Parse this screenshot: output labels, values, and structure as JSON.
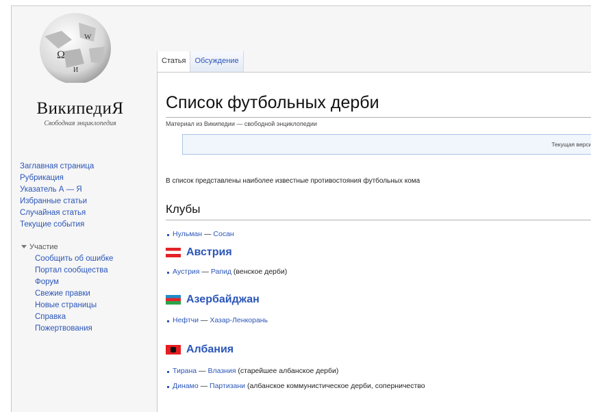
{
  "logo": {
    "wordmark": "ВикипедиЯ",
    "tagline": "Свободная энциклопедия"
  },
  "sidebar": {
    "nav": [
      {
        "label": "Заглавная страница"
      },
      {
        "label": "Рубрикация"
      },
      {
        "label": "Указатель А — Я"
      },
      {
        "label": "Избранные статьи"
      },
      {
        "label": "Случайная статья"
      },
      {
        "label": "Текущие события"
      }
    ],
    "portal_heading": "Участие",
    "portal_items": [
      {
        "label": "Сообщить об ошибке"
      },
      {
        "label": "Портал сообщества"
      },
      {
        "label": "Форум"
      },
      {
        "label": "Свежие правки"
      },
      {
        "label": "Новые страницы"
      },
      {
        "label": "Справка"
      },
      {
        "label": "Пожертвования"
      }
    ]
  },
  "tabs": [
    {
      "label": "Статья"
    },
    {
      "label": "Обсуждение"
    }
  ],
  "article": {
    "title": "Список футбольных дерби",
    "from": "Материал из Википедии — свободной энциклопедии",
    "notice": "Текущая версия",
    "intro": "В список представлены наиболее известные противостояния футбольных кома",
    "section_clubs": "Клубы",
    "club_items": [
      {
        "a": "Нульман",
        "sep": " — ",
        "b": "Сосан",
        "note": ""
      }
    ],
    "countries": [
      {
        "name": "Австрия",
        "items": [
          {
            "a": "Аустрия",
            "sep": " — ",
            "b": "Рапид",
            "note": " (венское дерби)"
          }
        ]
      },
      {
        "name": "Азербайджан",
        "items": [
          {
            "a": "Нефтчи",
            "sep": " — ",
            "b": "Хазар-Ленкорань",
            "note": ""
          }
        ]
      },
      {
        "name": "Албания",
        "items": [
          {
            "a": "Тирана",
            "sep": " — ",
            "b": "Влазния",
            "note": " (старейшее албанское дерби)"
          },
          {
            "a": "Динамо",
            "sep": " — ",
            "b": "Партизани",
            "note": " (албанское коммунистическое дерби, соперничество"
          }
        ]
      }
    ]
  },
  "colors": {
    "link": "#2a55b8",
    "notice_bg": "#f1f6fc",
    "notice_border": "#a8c4e6"
  },
  "icons": {
    "logo": "wikipedia-globe-icon",
    "flags": [
      "austria-flag-icon",
      "azerbaijan-flag-icon",
      "albania-flag-icon"
    ]
  }
}
